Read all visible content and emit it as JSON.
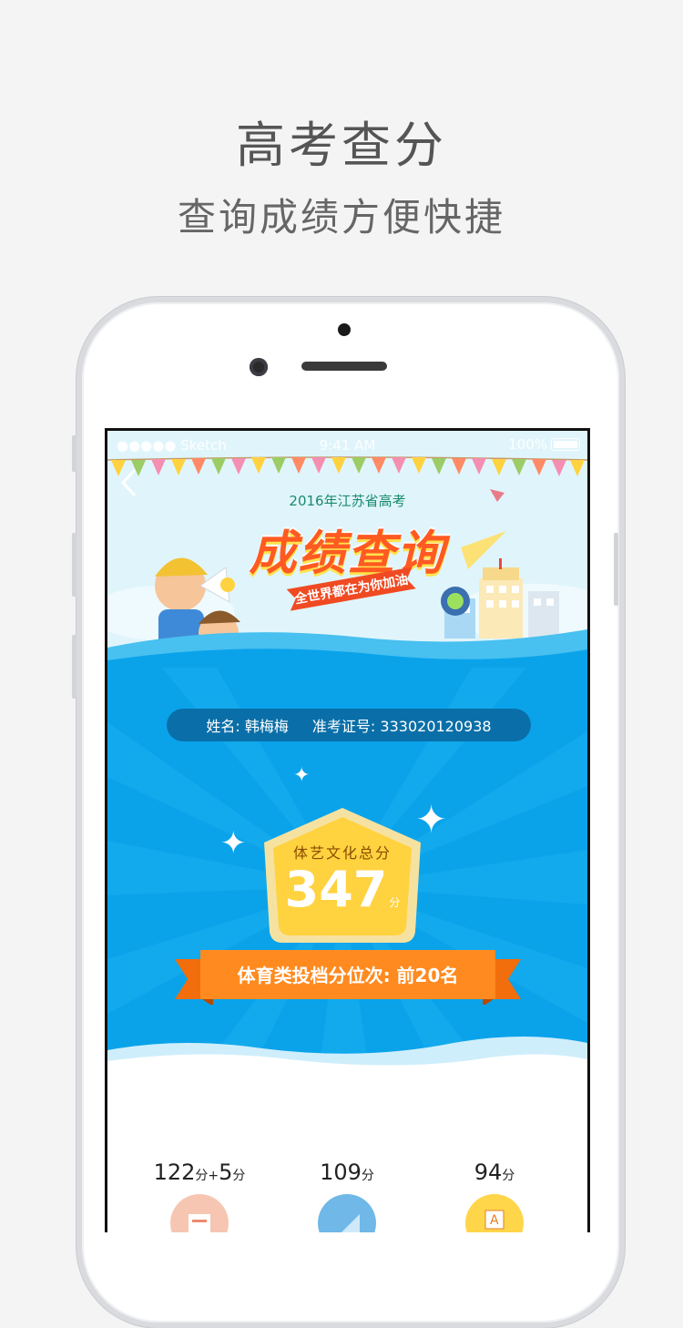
{
  "header": {
    "title": "高考查分",
    "subtitle": "查询成绩方便快捷"
  },
  "status_bar": {
    "carrier": "●●●●● Sketch",
    "time": "9:41 AM",
    "battery": "100%"
  },
  "hero": {
    "year_title": "2016年江苏省高考",
    "main_title": "成绩查询",
    "banner_text": "全世界都在为你加油"
  },
  "student": {
    "name_label": "姓名:",
    "name": "韩梅梅",
    "id_label": "准考证号:",
    "id": "333020120938"
  },
  "total": {
    "label": "体艺文化总分",
    "score": "347",
    "unit": "分"
  },
  "ranking": {
    "text": "体育类投档分位次: 前20名"
  },
  "subjects": [
    {
      "score": "122",
      "unit": "分",
      "bonus_sign": "+",
      "bonus": "5",
      "bonus_unit": "分",
      "color": "#f7c6b2",
      "icon": "book-icon"
    },
    {
      "score": "109",
      "unit": "分",
      "color": "#6fb8e8",
      "icon": "ruler-icon"
    },
    {
      "score": "94",
      "unit": "分",
      "color": "#ffd54a",
      "icon": "alphabet-icon"
    }
  ],
  "colors": {
    "sky": "#0aa3ea",
    "pill": "#0a6fa8",
    "ribbon": "#ff8a1f",
    "badge": "#ffd23f",
    "title_orange": "#ff5a22"
  }
}
